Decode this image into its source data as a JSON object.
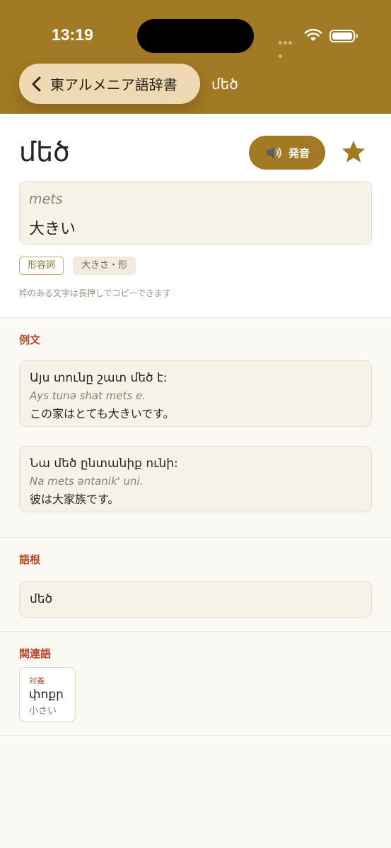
{
  "status_bar": {
    "time": "13:19"
  },
  "nav": {
    "back_label": "東アルメニア語辞書",
    "title": "մեծ"
  },
  "entry": {
    "word": "մեծ",
    "pronounce_label": "発音",
    "transliteration": "mets",
    "meaning": "大きい",
    "part_of_speech": "形容詞",
    "category": "大きさ・形",
    "copy_hint": "枠のある文字は長押しでコピーできます"
  },
  "examples": {
    "title": "例文",
    "items": [
      {
        "armenian": "Այս տունը շատ մեծ է:",
        "translit": "Ays tunə shat mets e.",
        "japanese": "この家はとても大きいです。"
      },
      {
        "armenian": "Նա մեծ ընտանիք ունի:",
        "translit": "Na mets əntanik' uni.",
        "japanese": "彼は大家族です。"
      }
    ]
  },
  "root": {
    "title": "語根",
    "value": "մեծ"
  },
  "related": {
    "title": "関連語",
    "items": [
      {
        "type": "対義",
        "word": "փոքր",
        "meaning": "小さい"
      }
    ]
  },
  "colors": {
    "accent": "#a27a24",
    "section_title": "#b54a2c",
    "back_button_bg": "#eed9b3",
    "box_bg": "#f7f2e8"
  },
  "icons": {
    "back": "chevron-left-icon",
    "pronounce": "speaker-icon",
    "favorite": "star-icon"
  }
}
